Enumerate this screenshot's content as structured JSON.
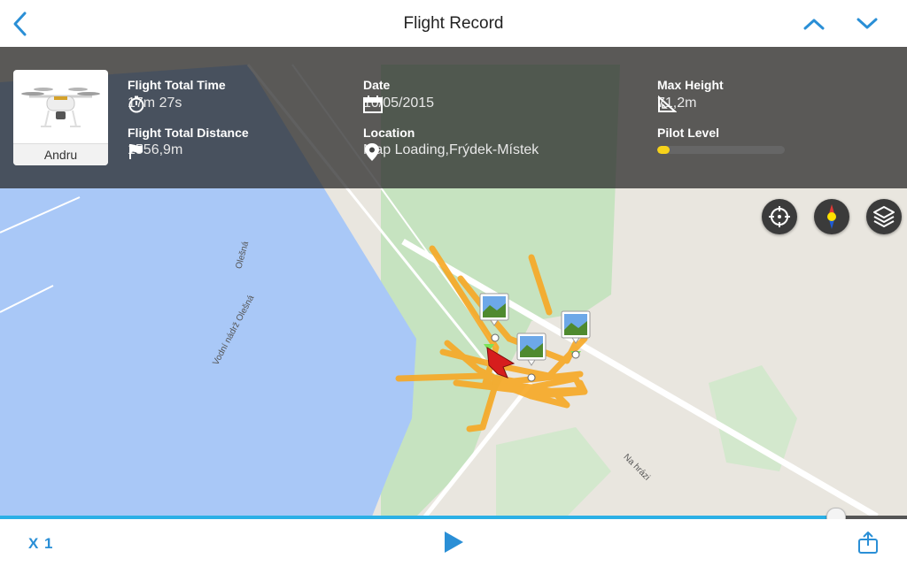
{
  "header": {
    "title": "Flight Record",
    "back_icon": "chevron-left-icon",
    "prev_icon": "chevron-up-icon",
    "next_icon": "chevron-down-icon",
    "accent": "#2a8fd6"
  },
  "info": {
    "aircraft_name": "Andru",
    "total_time_label": "Flight Total Time",
    "total_time_value": "17m 27s",
    "total_distance_label": "Flight Total Distance",
    "total_distance_value": "1556,9m",
    "date_label": "Date",
    "date_value": "10/05/2015",
    "location_label": "Location",
    "location_value": "Map Loading,Frýdek-Místek",
    "max_height_label": "Max Height",
    "max_height_value": "71,2m",
    "pilot_level_label": "Pilot Level",
    "pilot_level_fraction": 0.1,
    "pilot_level_color": "#f6d21a"
  },
  "map": {
    "water_color": "#a9c8f7",
    "park_color": "#c6e3c0",
    "land_color": "#e9e6df",
    "track_color": "#f7a824",
    "street_labels": [
      "Olešná",
      "Vodní nádrž Olešná",
      "Na hrázi"
    ],
    "controls": [
      "locate-icon",
      "compass-icon",
      "layers-icon"
    ]
  },
  "playback": {
    "progress_fraction": 0.922,
    "speed_label": "X 1",
    "play_icon": "play-icon",
    "share_icon": "share-icon",
    "progress_color": "#2bb0e6"
  }
}
